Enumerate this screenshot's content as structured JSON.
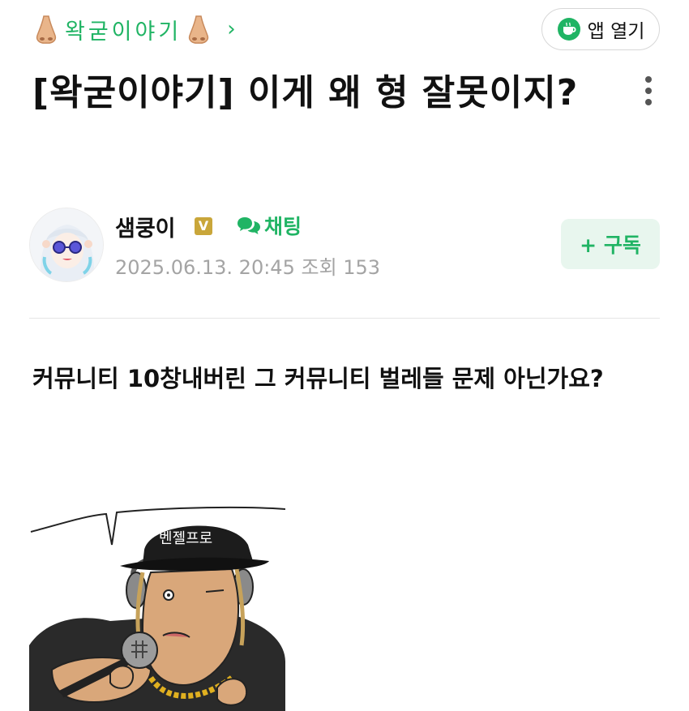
{
  "header": {
    "cafe_name": "왁굳이야기",
    "chevron": "›",
    "app_button_label": "앱 열기"
  },
  "post": {
    "title": "[왁굳이야기] 이게 왜 형 잘못이지?",
    "author": "샘쿵이",
    "badge": "V",
    "chat_label": "채팅",
    "date": "2025.06.13. 20:45",
    "views": "조회 153",
    "subscribe_label": "+ 구독",
    "body": "커뮤니티 10창내버린 그 커뮤니티 벌레들 문제 아닌가요?",
    "image_text": "벤젤프로"
  },
  "colors": {
    "accent": "#20b464",
    "badge": "#c9a63a",
    "meta": "#a4a4a4"
  },
  "icons": {
    "cafe_left": "nose-icon",
    "cafe_right": "nose-icon",
    "app": "coffee-cup-icon",
    "more": "kebab-icon",
    "chat": "chat-bubble-icon"
  }
}
